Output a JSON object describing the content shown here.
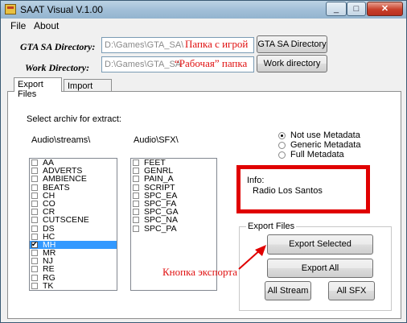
{
  "window": {
    "title": "SAAT Visual V.1.00",
    "minimize": "_",
    "maximize": "□",
    "close": "✕"
  },
  "menu": [
    "File",
    "About"
  ],
  "paths": {
    "gta_label": "GTA SA Directory:",
    "gta_value": "D:\\Games\\GTA_SA\\",
    "gta_button": "GTA SA Directory",
    "gta_annotation": "Папка с игрой",
    "work_label": "Work Directory:",
    "work_value": "D:\\Games\\GTA_SA",
    "work_button": "Work directory",
    "work_annotation": "“Рабочая” папка"
  },
  "tabs": [
    "Export Files",
    "Import Files"
  ],
  "panel": {
    "select_label": "Select archiv for extract:",
    "streams_header": "Audio\\streams\\",
    "sfx_header": "Audio\\SFX\\",
    "streams": [
      {
        "label": "AA",
        "checked": false,
        "selected": false
      },
      {
        "label": "ADVERTS",
        "checked": false,
        "selected": false
      },
      {
        "label": "AMBIENCE",
        "checked": false,
        "selected": false
      },
      {
        "label": "BEATS",
        "checked": false,
        "selected": false
      },
      {
        "label": "CH",
        "checked": false,
        "selected": false
      },
      {
        "label": "CO",
        "checked": false,
        "selected": false
      },
      {
        "label": "CR",
        "checked": false,
        "selected": false
      },
      {
        "label": "CUTSCENE",
        "checked": false,
        "selected": false
      },
      {
        "label": "DS",
        "checked": false,
        "selected": false
      },
      {
        "label": "HC",
        "checked": false,
        "selected": false
      },
      {
        "label": "MH",
        "checked": true,
        "selected": true
      },
      {
        "label": "MR",
        "checked": false,
        "selected": false
      },
      {
        "label": "NJ",
        "checked": false,
        "selected": false
      },
      {
        "label": "RE",
        "checked": false,
        "selected": false
      },
      {
        "label": "RG",
        "checked": false,
        "selected": false
      },
      {
        "label": "TK",
        "checked": false,
        "selected": false
      }
    ],
    "sfx": [
      {
        "label": "FEET",
        "checked": false
      },
      {
        "label": "GENRL",
        "checked": false
      },
      {
        "label": "PAIN_A",
        "checked": false
      },
      {
        "label": "SCRIPT",
        "checked": false
      },
      {
        "label": "SPC_EA",
        "checked": false
      },
      {
        "label": "SPC_FA",
        "checked": false
      },
      {
        "label": "SPC_GA",
        "checked": false
      },
      {
        "label": "SPC_NA",
        "checked": false
      },
      {
        "label": "SPC_PA",
        "checked": false
      }
    ],
    "metadata_options": [
      {
        "label": "Not use Metadata",
        "selected": true
      },
      {
        "label": "Generic Metadata",
        "selected": false
      },
      {
        "label": "Full Metadata",
        "selected": false
      }
    ],
    "info_label": "Info:",
    "info_value": "Radio Los Santos",
    "export_group": "Export Files",
    "export_selected": "Export Selected",
    "export_all": "Export All",
    "all_stream": "All Stream",
    "all_sfx": "All SFX",
    "export_annotation": "Кнопка экспорта"
  },
  "colors": {
    "annotation": "#e01010",
    "highlight": "#3399ff"
  }
}
